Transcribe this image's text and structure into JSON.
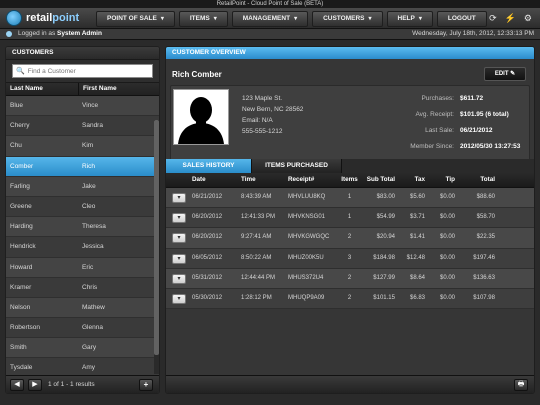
{
  "window": {
    "title": "RetailPoint - Cloud Point of Sale (BETA)"
  },
  "brand": {
    "name_part1": "retail",
    "name_part2": "point"
  },
  "menu": [
    {
      "label": "POINT OF SALE"
    },
    {
      "label": "ITEMS"
    },
    {
      "label": "MANAGEMENT"
    },
    {
      "label": "CUSTOMERS"
    },
    {
      "label": "HELP"
    },
    {
      "label": "LOGOUT"
    }
  ],
  "status": {
    "logged_in_prefix": "Logged in as ",
    "user": "System Admin",
    "datetime": "Wednesday, July 18th, 2012, 12:33:13 PM"
  },
  "customers_panel": {
    "title": "CUSTOMERS",
    "search_placeholder": "Find a Customer",
    "col_last": "Last Name",
    "col_first": "First Name",
    "rows": [
      {
        "last": "Blue",
        "first": "Vince"
      },
      {
        "last": "Cherry",
        "first": "Sandra"
      },
      {
        "last": "Chu",
        "first": "Kim"
      },
      {
        "last": "Comber",
        "first": "Rich"
      },
      {
        "last": "Farling",
        "first": "Jake"
      },
      {
        "last": "Greene",
        "first": "Cleo"
      },
      {
        "last": "Harding",
        "first": "Theresa"
      },
      {
        "last": "Hendrick",
        "first": "Jessica"
      },
      {
        "last": "Howard",
        "first": "Eric"
      },
      {
        "last": "Kramer",
        "first": "Chris"
      },
      {
        "last": "Nelson",
        "first": "Mathew"
      },
      {
        "last": "Robertson",
        "first": "Glenna"
      },
      {
        "last": "Smith",
        "first": "Gary"
      },
      {
        "last": "Tysdale",
        "first": "Amy"
      }
    ],
    "selected_index": 3,
    "pager": "1 of 1 - 1 results"
  },
  "overview": {
    "title": "CUSTOMER OVERVIEW",
    "name": "Rich Comber",
    "edit_label": "EDIT",
    "address": {
      "line1": "123 Maple St.",
      "line2": "New Bern, NC 28562",
      "email": "Email: N/A",
      "phone": "555-555-1212"
    },
    "stats": {
      "purchases_label": "Purchases:",
      "purchases": "$611.72",
      "avg_label": "Avg. Receipt:",
      "avg": "$101.95 (6 total)",
      "last_label": "Last Sale:",
      "last": "06/21/2012",
      "since_label": "Member Since:",
      "since": "2012/05/30 13:27:53"
    },
    "tabs": [
      {
        "label": "SALES HISTORY"
      },
      {
        "label": "ITEMS PURCHASED"
      }
    ],
    "table": {
      "headers": [
        "Date",
        "Time",
        "Receipt#",
        "Items",
        "Sub Total",
        "Tax",
        "Tip",
        "Total"
      ],
      "rows": [
        [
          "06/21/2012",
          "8:43:39 AM",
          "MHVLUU8KQ",
          "1",
          "$83.00",
          "$5.60",
          "$0.00",
          "$88.60"
        ],
        [
          "06/20/2012",
          "12:41:33 PM",
          "MHVKNSG01",
          "1",
          "$54.99",
          "$3.71",
          "$0.00",
          "$58.70"
        ],
        [
          "06/20/2012",
          "9:27:41 AM",
          "MHVKGWGQC",
          "2",
          "$20.94",
          "$1.41",
          "$0.00",
          "$22.35"
        ],
        [
          "06/05/2012",
          "8:50:22 AM",
          "MHUZ00K5U",
          "3",
          "$184.98",
          "$12.48",
          "$0.00",
          "$197.46"
        ],
        [
          "05/31/2012",
          "12:44:44 PM",
          "MHUS372U4",
          "2",
          "$127.99",
          "$8.64",
          "$0.00",
          "$136.63"
        ],
        [
          "05/30/2012",
          "1:28:12 PM",
          "MHUQP9A09",
          "2",
          "$101.15",
          "$6.83",
          "$0.00",
          "$107.98"
        ]
      ]
    }
  },
  "colors": {
    "accent": "#2a8dca",
    "accent_light": "#56b6ea"
  }
}
